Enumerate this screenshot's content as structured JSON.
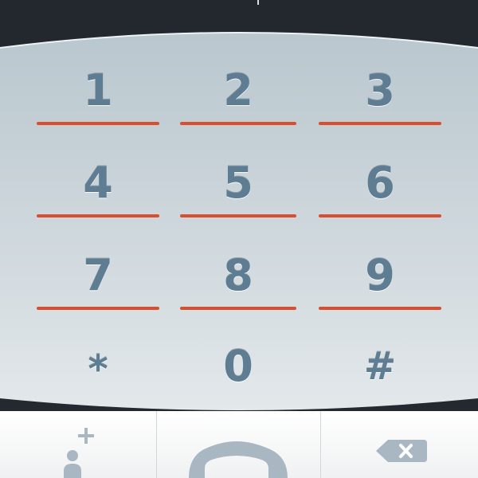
{
  "keypad": {
    "keys": [
      {
        "label": "1",
        "name": "key-1"
      },
      {
        "label": "2",
        "name": "key-2"
      },
      {
        "label": "3",
        "name": "key-3"
      },
      {
        "label": "4",
        "name": "key-4"
      },
      {
        "label": "5",
        "name": "key-5"
      },
      {
        "label": "6",
        "name": "key-6"
      },
      {
        "label": "7",
        "name": "key-7"
      },
      {
        "label": "8",
        "name": "key-8"
      },
      {
        "label": "9",
        "name": "key-9"
      },
      {
        "label": "*",
        "name": "key-star"
      },
      {
        "label": "0",
        "name": "key-0"
      },
      {
        "label": "#",
        "name": "key-hash"
      }
    ]
  },
  "actions": {
    "add_contact_icon": "add-contact-icon",
    "call_icon": "phone-handset-icon",
    "backspace_icon": "backspace-icon"
  },
  "colors": {
    "digit": "#5e7d92",
    "underline": "#d84e2e",
    "icon": "#a9b7c2",
    "topbar": "#23282e"
  }
}
